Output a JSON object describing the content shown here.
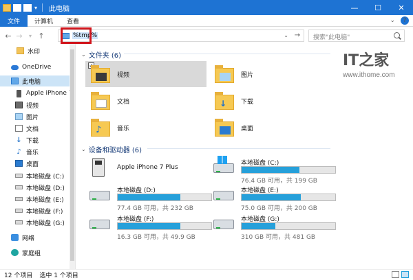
{
  "window": {
    "title": "此电脑"
  },
  "ribbon": {
    "tabs": [
      "文件",
      "计算机",
      "查看"
    ]
  },
  "address": {
    "value": "%tmp%"
  },
  "search": {
    "placeholder": "搜索\"此电脑\""
  },
  "nav": {
    "items": [
      {
        "label": "水印",
        "icon": "folder-icon"
      },
      {
        "label": "OneDrive",
        "icon": "onedrive-icon"
      },
      {
        "label": "此电脑",
        "icon": "pc-icon",
        "selected": true
      },
      {
        "label": "Apple iPhone 7",
        "icon": "phone-icon"
      },
      {
        "label": "视频",
        "icon": "video-folder-icon"
      },
      {
        "label": "图片",
        "icon": "pictures-folder-icon"
      },
      {
        "label": "文档",
        "icon": "documents-folder-icon"
      },
      {
        "label": "下载",
        "icon": "download-folder-icon"
      },
      {
        "label": "音乐",
        "icon": "music-folder-icon"
      },
      {
        "label": "桌面",
        "icon": "desktop-folder-icon"
      },
      {
        "label": "本地磁盘 (C:)",
        "icon": "drive-icon"
      },
      {
        "label": "本地磁盘 (D:)",
        "icon": "drive-icon"
      },
      {
        "label": "本地磁盘 (E:)",
        "icon": "drive-icon"
      },
      {
        "label": "本地磁盘 (F:)",
        "icon": "drive-icon"
      },
      {
        "label": "本地磁盘 (G:)",
        "icon": "drive-icon"
      },
      {
        "label": "网络",
        "icon": "network-icon"
      },
      {
        "label": "家庭组",
        "icon": "homegroup-icon"
      }
    ]
  },
  "folders": {
    "header": "文件夹 (6)",
    "items": [
      {
        "label": "视频",
        "icon": "video-folder-icon",
        "selected": true
      },
      {
        "label": "图片",
        "icon": "pictures-folder-icon"
      },
      {
        "label": "文档",
        "icon": "documents-folder-icon"
      },
      {
        "label": "下载",
        "icon": "download-folder-icon"
      },
      {
        "label": "音乐",
        "icon": "music-folder-icon"
      },
      {
        "label": "桌面",
        "icon": "desktop-folder-icon"
      }
    ]
  },
  "devices": {
    "header": "设备和驱动器 (6)",
    "items": [
      {
        "label": "Apple iPhone 7 Plus",
        "icon": "phone-icon"
      },
      {
        "label": "本地磁盘 (C:)",
        "free": "76.4 GB 可用，共 199 GB",
        "used_fraction": 0.62,
        "icon": "windows-drive-icon"
      },
      {
        "label": "本地磁盘 (D:)",
        "free": "77.4 GB 可用，共 232 GB",
        "used_fraction": 0.67,
        "icon": "drive-icon"
      },
      {
        "label": "本地磁盘 (E:)",
        "free": "75.0 GB 可用，共 200 GB",
        "used_fraction": 0.63,
        "icon": "drive-icon"
      },
      {
        "label": "本地磁盘 (F:)",
        "free": "16.3 GB 可用，共 49.9 GB",
        "used_fraction": 0.67,
        "icon": "drive-icon"
      },
      {
        "label": "本地磁盘 (G:)",
        "free": "310 GB 可用，共 481 GB",
        "used_fraction": 0.36,
        "icon": "drive-icon"
      }
    ]
  },
  "watermark": {
    "logo": "IT之家",
    "url": "www.ithome.com"
  },
  "status": {
    "count": "12 个项目",
    "selected": "选中 1 个项目"
  },
  "colors": {
    "accent": "#1e73d3",
    "bar": "#26a0da",
    "selection": "#cce4f7"
  }
}
